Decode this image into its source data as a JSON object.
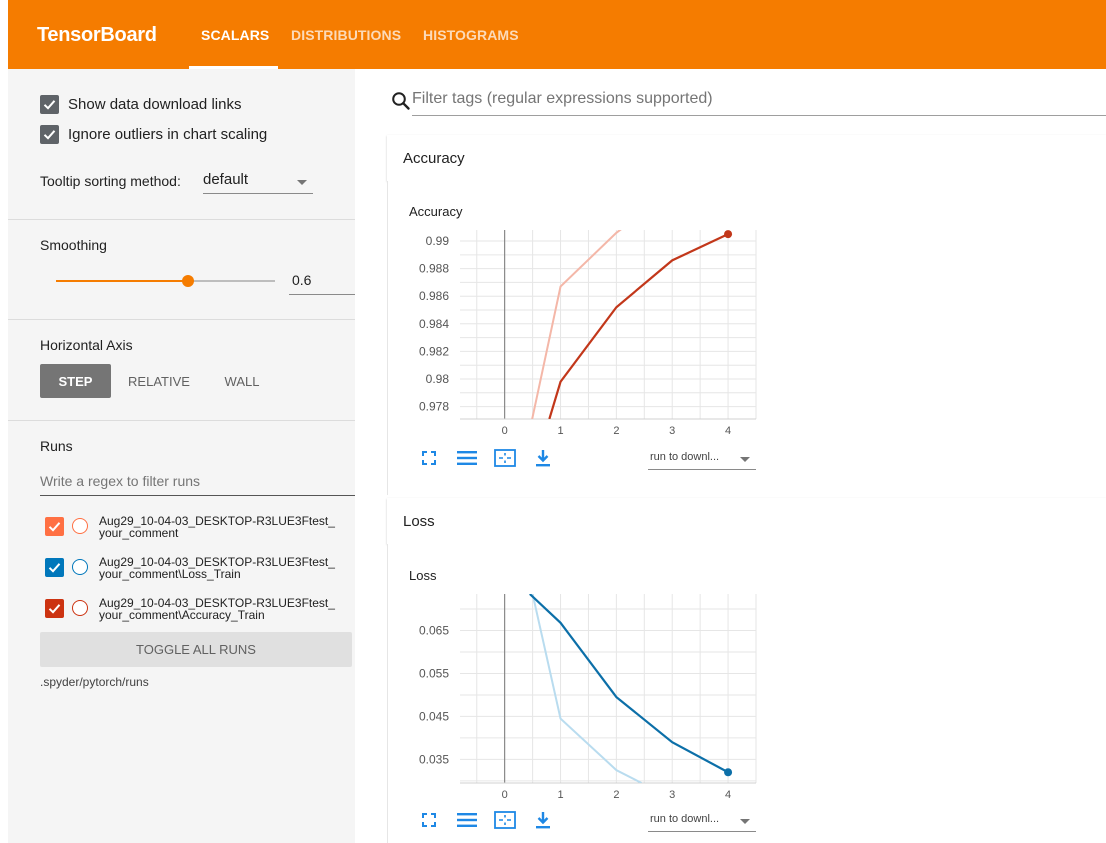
{
  "header": {
    "brand": "TensorBoard",
    "tabs": [
      {
        "label": "SCALARS",
        "active": true
      },
      {
        "label": "DISTRIBUTIONS",
        "active": false
      },
      {
        "label": "HISTOGRAMS",
        "active": false
      }
    ],
    "color": "#f57c00"
  },
  "sidebar": {
    "show_download_links": {
      "label": "Show data download links",
      "checked": true
    },
    "ignore_outliers": {
      "label": "Ignore outliers in chart scaling",
      "checked": true
    },
    "tooltip_sorting": {
      "label": "Tooltip sorting method:",
      "value": "default"
    },
    "smoothing": {
      "title": "Smoothing",
      "value": "0.6",
      "level": 0.6
    },
    "horizontal_axis": {
      "title": "Horizontal Axis",
      "options": [
        {
          "label": "STEP",
          "selected": true
        },
        {
          "label": "RELATIVE",
          "selected": false
        },
        {
          "label": "WALL",
          "selected": false
        }
      ]
    },
    "runs": {
      "title": "Runs",
      "filter_placeholder": "Write a regex to filter runs",
      "items": [
        {
          "line1": "Aug29_10-04-03_DESKTOP-R3LUE3Ftest_",
          "line2": "your_comment",
          "color": "#ff7043",
          "checked": true
        },
        {
          "line1": "Aug29_10-04-03_DESKTOP-R3LUE3Ftest_",
          "line2": "your_comment\\Loss_Train",
          "color": "#0077bb",
          "checked": true
        },
        {
          "line1": "Aug29_10-04-03_DESKTOP-R3LUE3Ftest_",
          "line2": "your_comment\\Accuracy_Train",
          "color": "#cc3311",
          "checked": true
        }
      ],
      "toggle_label": "TOGGLE ALL RUNS",
      "path": ".spyder/pytorch/runs"
    }
  },
  "main": {
    "search_placeholder": "Filter tags (regular expressions supported)",
    "run_select_label": "run to downl..."
  },
  "chart_data": [
    {
      "type": "line",
      "card": "Accuracy",
      "title": "Accuracy",
      "x_ticks": [
        "0",
        "1",
        "2",
        "3",
        "4"
      ],
      "y_ticks": [
        "0.99",
        "0.988",
        "0.986",
        "0.984",
        "0.982",
        "0.98",
        "0.978"
      ],
      "xlim": [
        -0.8,
        4.5
      ],
      "ylim": [
        0.9771,
        0.9908
      ],
      "series": [
        {
          "style": "raw",
          "color": "#f4b7a8",
          "x": [
            0.45,
            1,
            2,
            2.2
          ],
          "y": [
            0.9763,
            0.9867,
            0.9906,
            0.9912
          ]
        },
        {
          "style": "smoothed",
          "color": "#c2371a",
          "x": [
            0.8,
            1,
            2,
            3,
            4
          ],
          "y": [
            0.9771,
            0.9798,
            0.9852,
            0.9886,
            0.9905
          ]
        }
      ]
    },
    {
      "type": "line",
      "card": "Loss",
      "title": "Loss",
      "x_ticks": [
        "0",
        "1",
        "2",
        "3",
        "4"
      ],
      "y_ticks": [
        "0.065",
        "0.055",
        "0.045",
        "0.035"
      ],
      "xlim": [
        -0.8,
        4.5
      ],
      "ylim": [
        0.0295,
        0.0735
      ],
      "series": [
        {
          "style": "raw",
          "color": "#b9dcef",
          "x": [
            0.5,
            1,
            2,
            2.45
          ],
          "y": [
            0.0735,
            0.0445,
            0.0325,
            0.0295
          ]
        },
        {
          "style": "smoothed",
          "color": "#0c6fa8",
          "x": [
            0.45,
            1,
            2,
            3,
            4
          ],
          "y": [
            0.0735,
            0.0668,
            0.0495,
            0.039,
            0.032
          ]
        }
      ]
    }
  ]
}
